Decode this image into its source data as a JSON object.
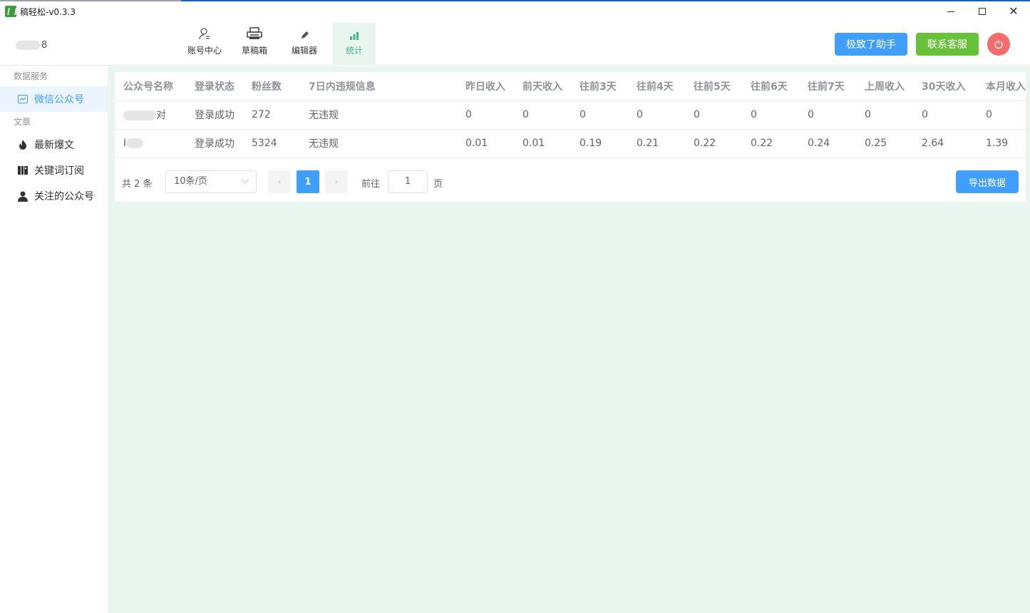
{
  "window": {
    "title": "稿轻松-v0.3.3"
  },
  "header": {
    "user_suffix": "8",
    "nav": [
      {
        "label": "账号中心",
        "icon": "user-icon"
      },
      {
        "label": "草稿箱",
        "icon": "printer-icon"
      },
      {
        "label": "编辑器",
        "icon": "pen-icon"
      },
      {
        "label": "统计",
        "icon": "bar-chart-icon",
        "active": true
      }
    ],
    "assistant_label": "极致了助手",
    "service_label": "联系客服",
    "colors": {
      "primary": "#409eff",
      "success": "#67c23a",
      "danger": "#f56c6c",
      "active_nav": "#42b983"
    }
  },
  "sidebar": {
    "group_data": "数据服务",
    "wechat": "微信公众号",
    "group_article": "文章",
    "hot": "最新爆文",
    "keyword": "关键词订阅",
    "follow": "关注的公众号"
  },
  "table": {
    "headers": [
      "公众号名称",
      "登录状态",
      "粉丝数",
      "7日内违规信息",
      "昨日收入",
      "前天收入",
      "往前3天",
      "往前4天",
      "往前5天",
      "往前6天",
      "往前7天",
      "上周收入",
      "30天收入",
      "本月收入"
    ],
    "rows": [
      {
        "name": "对",
        "status": "登录成功",
        "fans": "272",
        "violation": "无违规",
        "income": [
          "0",
          "0",
          "0",
          "0",
          "0",
          "0",
          "0",
          "0",
          "0",
          "0"
        ]
      },
      {
        "name": "I",
        "status": "登录成功",
        "fans": "5324",
        "violation": "无违规",
        "income": [
          "0.01",
          "0.01",
          "0.19",
          "0.21",
          "0.22",
          "0.22",
          "0.24",
          "0.25",
          "2.64",
          "1.39"
        ]
      }
    ]
  },
  "pager": {
    "total": "共 2 条",
    "page_size": "10条/页",
    "current": "1",
    "goto": "前往",
    "goto_value": "1",
    "page_unit": "页",
    "export_label": "导出数据"
  }
}
